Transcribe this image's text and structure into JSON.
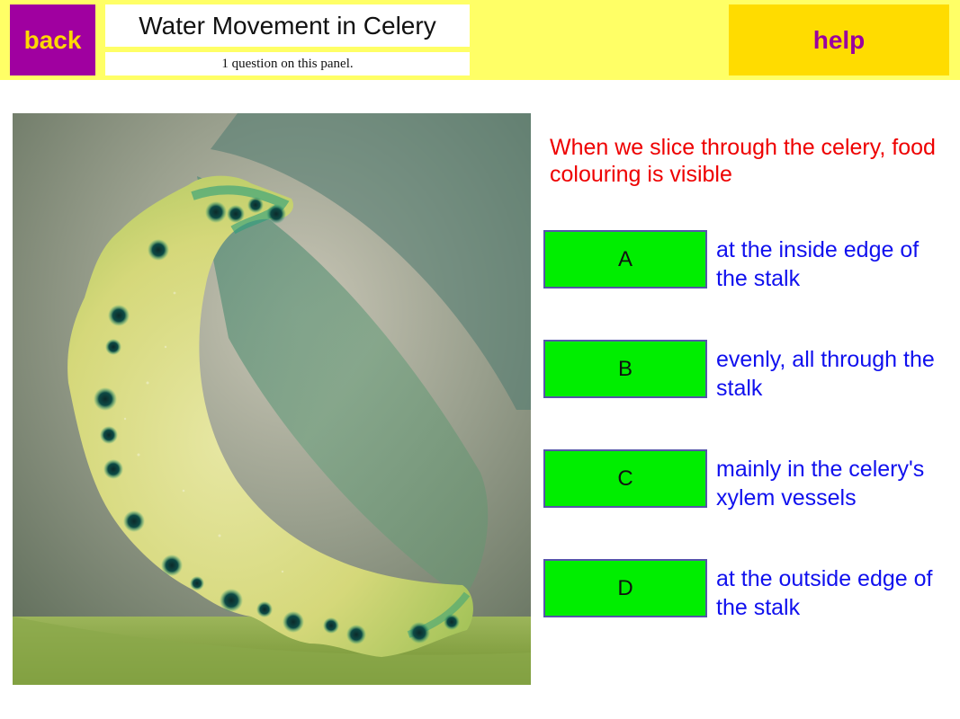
{
  "header": {
    "back_label": "back",
    "title": "Water Movement in Celery",
    "subtitle": "1 question on this panel.",
    "help_label": "help"
  },
  "question": {
    "text": "When we slice through the celery, food colouring is visible"
  },
  "options": [
    {
      "letter": "A",
      "text": "at the inside edge of the stalk"
    },
    {
      "letter": "B",
      "text": "evenly, all through the stalk"
    },
    {
      "letter": "C",
      "text": "mainly in the celery's xylem vessels"
    },
    {
      "letter": "D",
      "text": "at the outside edge of the stalk"
    }
  ],
  "colors": {
    "header_bg": "#ffff66",
    "back_bg": "#a000a0",
    "help_bg": "#ffdc00",
    "option_bg": "#00ee00",
    "question_text": "#ee0000",
    "option_text": "#1010ee"
  }
}
